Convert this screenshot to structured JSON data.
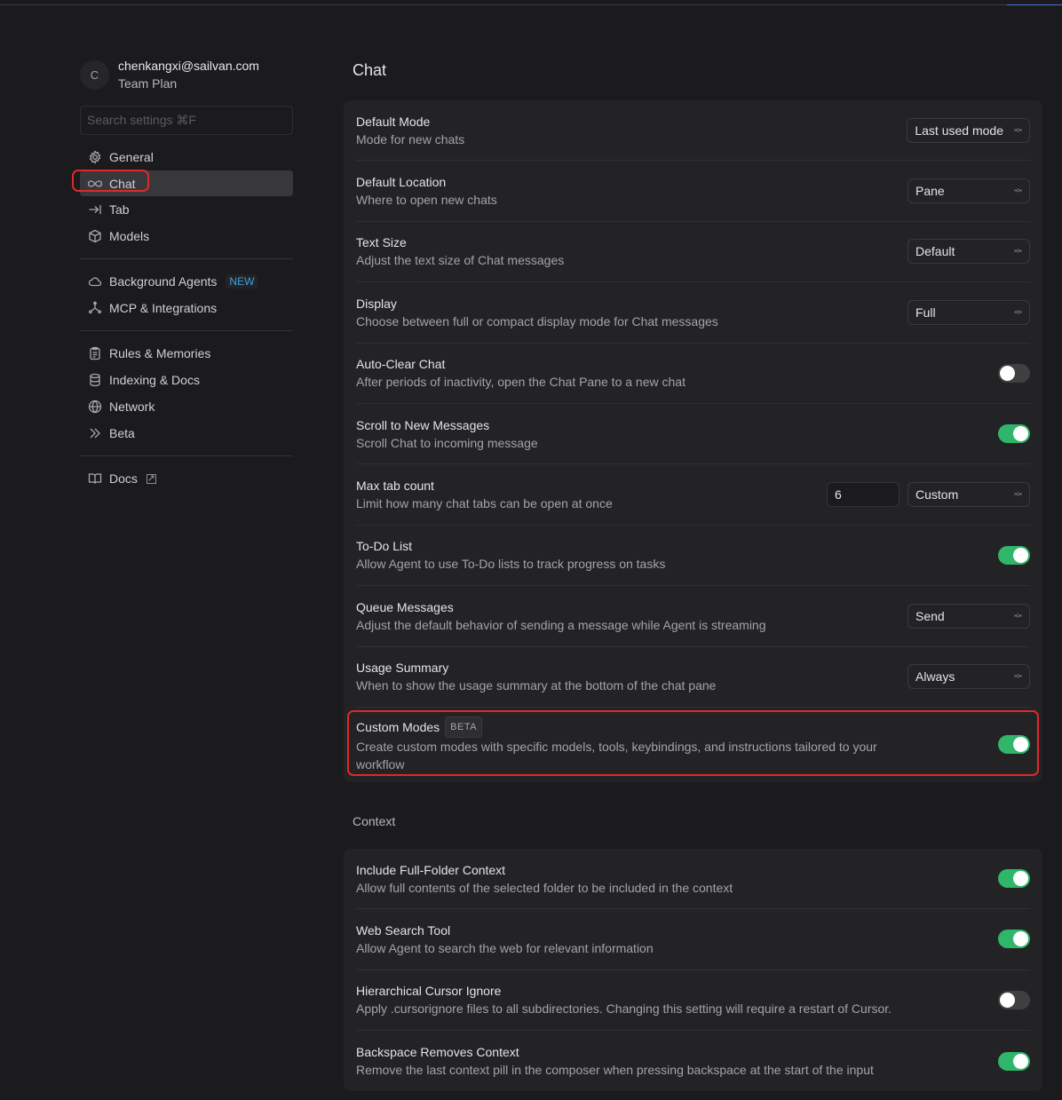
{
  "user": {
    "initial": "C",
    "email": "chenkangxi@sailvan.com",
    "plan": "Team Plan"
  },
  "search": {
    "placeholder": "Search settings ⌘F"
  },
  "nav": {
    "group1": [
      {
        "label": "General",
        "icon": "gear-icon"
      },
      {
        "label": "Chat",
        "icon": "infinity-icon",
        "active": true
      },
      {
        "label": "Tab",
        "icon": "tab-arrow-icon"
      },
      {
        "label": "Models",
        "icon": "cube-icon"
      }
    ],
    "group2": [
      {
        "label": "Background Agents",
        "icon": "cloud-icon",
        "badge": "NEW"
      },
      {
        "label": "MCP & Integrations",
        "icon": "network-nodes-icon"
      }
    ],
    "group3": [
      {
        "label": "Rules & Memories",
        "icon": "clipboard-icon"
      },
      {
        "label": "Indexing & Docs",
        "icon": "database-icon"
      },
      {
        "label": "Network",
        "icon": "globe-icon"
      },
      {
        "label": "Beta",
        "icon": "chevrons-right-icon"
      }
    ],
    "group4": [
      {
        "label": "Docs",
        "icon": "book-icon"
      }
    ]
  },
  "main": {
    "title": "Chat",
    "rows": [
      {
        "title": "Default Mode",
        "desc": "Mode for new chats",
        "select": "Last used mode"
      },
      {
        "title": "Default Location",
        "desc": "Where to open new chats",
        "select": "Pane"
      },
      {
        "title": "Text Size",
        "desc": "Adjust the text size of Chat messages",
        "select": "Default"
      },
      {
        "title": "Display",
        "desc": "Choose between full or compact display mode for Chat messages",
        "select": "Full"
      },
      {
        "title": "Auto-Clear Chat",
        "desc": "After periods of inactivity, open the Chat Pane to a new chat",
        "toggle": false
      },
      {
        "title": "Scroll to New Messages",
        "desc": "Scroll Chat to incoming message",
        "toggle": true
      },
      {
        "title": "Max tab count",
        "desc": "Limit how many chat tabs can be open at once",
        "input": "6",
        "select": "Custom"
      },
      {
        "title": "To-Do List",
        "desc": "Allow Agent to use To-Do lists to track progress on tasks",
        "toggle": true
      },
      {
        "title": "Queue Messages",
        "desc": "Adjust the default behavior of sending a message while Agent is streaming",
        "select": "Send"
      },
      {
        "title": "Usage Summary",
        "desc": "When to show the usage summary at the bottom of the chat pane",
        "select": "Always"
      },
      {
        "title": "Custom Modes",
        "badge": "BETA",
        "desc": "Create custom modes with specific models, tools, keybindings, and instructions tailored to your workflow",
        "toggle": true
      }
    ],
    "context": {
      "title": "Context",
      "rows": [
        {
          "title": "Include Full-Folder Context",
          "desc": "Allow full contents of the selected folder to be included in the context",
          "toggle": true
        },
        {
          "title": "Web Search Tool",
          "desc": "Allow Agent to search the web for relevant information",
          "toggle": true
        },
        {
          "title": "Hierarchical Cursor Ignore",
          "desc": "Apply .cursorignore files to all subdirectories. Changing this setting will require a restart of Cursor.",
          "toggle": false
        },
        {
          "title": "Backspace Removes Context",
          "desc": "Remove the last context pill in the composer when pressing backspace at the start of the input",
          "toggle": true
        }
      ]
    }
  },
  "colors": {
    "toggle_on": "#2fb66a",
    "highlight": "#e0282a",
    "new_badge": "#3aa0e0"
  }
}
